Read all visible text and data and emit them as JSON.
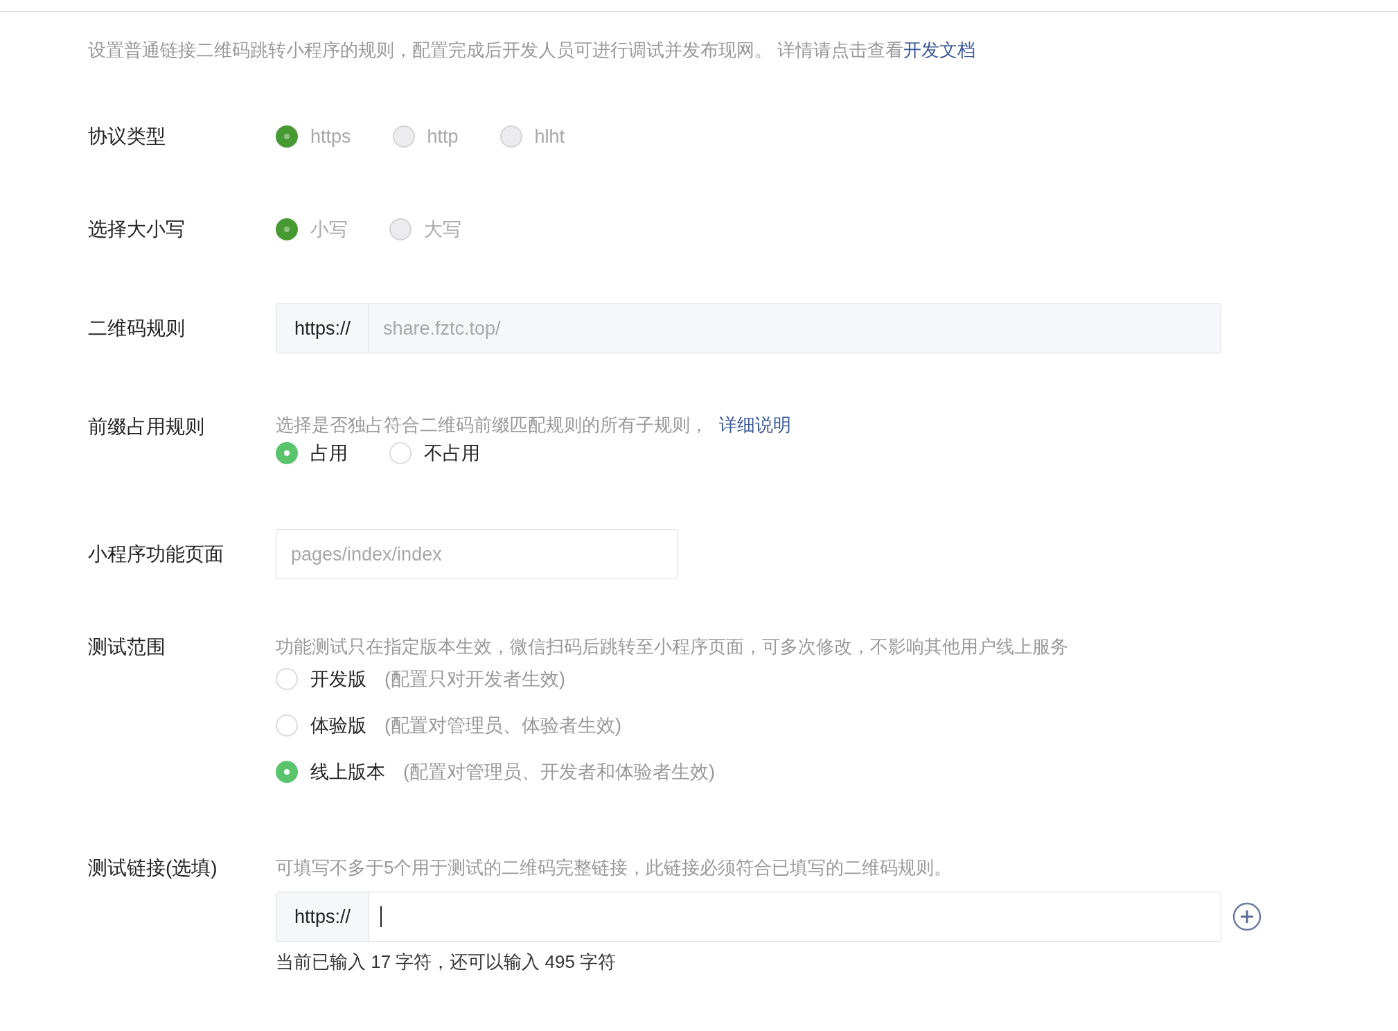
{
  "description": {
    "text": "设置普通链接二维码跳转小程序的规则，配置完成后开发人员可进行调试并发布现网。 详情请点击查看",
    "link": "开发文档"
  },
  "fields": [
    {
      "kind": "radio",
      "label": "协议类型",
      "options": [
        {
          "label": "https",
          "selected": true,
          "disabled": true
        },
        {
          "label": "http",
          "selected": false,
          "disabled": true
        },
        {
          "label": "hlht",
          "selected": false,
          "disabled": true
        }
      ]
    },
    {
      "kind": "radio",
      "label": "选择大小写",
      "options": [
        {
          "label": "小写",
          "selected": true,
          "disabled": true
        },
        {
          "label": "大写",
          "selected": false,
          "disabled": true
        }
      ]
    },
    {
      "kind": "prefix_input",
      "label": "二维码规则",
      "prefix": "https://",
      "placeholder": "share.fztc.top/"
    },
    {
      "kind": "radio",
      "label": "前缀占用规则",
      "hint": "选择是否独占符合二维码前缀匹配规则的所有子规则，",
      "hint_link": "详细说明",
      "options": [
        {
          "label": "占用",
          "selected": true,
          "disabled": false
        },
        {
          "label": "不占用",
          "selected": false,
          "disabled": false
        }
      ]
    },
    {
      "kind": "input",
      "label": "小程序功能页面",
      "placeholder": "pages/index/index"
    },
    {
      "kind": "radio_list",
      "label": "测试范围",
      "hint": "功能测试只在指定版本生效，微信扫码后跳转至小程序页面，可多次修改，不影响其他用户线上服务",
      "options": [
        {
          "label": "开发版",
          "note": "(配置只对开发者生效)",
          "selected": false,
          "disabled": false
        },
        {
          "label": "体验版",
          "note": "(配置对管理员、体验者生效)",
          "selected": false,
          "disabled": false
        },
        {
          "label": "线上版本",
          "note": "(配置对管理员、开发者和体验者生效)",
          "selected": true,
          "disabled": false
        }
      ]
    },
    {
      "kind": "link_input",
      "label": "测试链接(选填)",
      "hint": "可填写不多于5个用于测试的二维码完整链接，此链接必须符合已填写的二维码规则。",
      "prefix": "https://",
      "counter": "当前已输入 17 字符，还可以输入 495 字符"
    }
  ]
}
